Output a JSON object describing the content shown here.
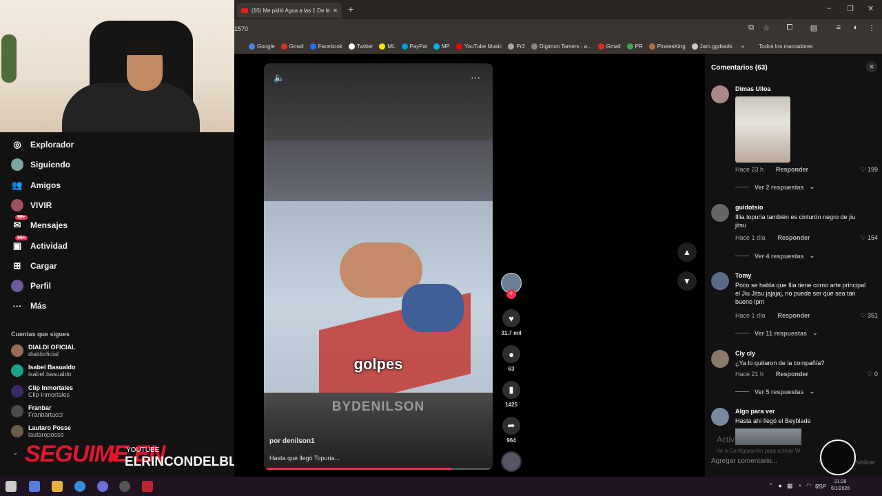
{
  "browser": {
    "tab_title": "(10) Me pidió Agua a las 1 De la",
    "new_tab": "+",
    "url_partial": "1570",
    "window_controls": [
      "–",
      "❐",
      "✕"
    ],
    "bookmarks": [
      {
        "label": "Google",
        "color": "#4285f4"
      },
      {
        "label": "Gmail",
        "color": "#d93025"
      },
      {
        "label": "Facebook",
        "color": "#1877f2"
      },
      {
        "label": "Twitter",
        "color": "#ffffff"
      },
      {
        "label": "ML",
        "color": "#ffe600"
      },
      {
        "label": "PayPal",
        "color": "#009cde"
      },
      {
        "label": "MP",
        "color": "#00b1ea"
      },
      {
        "label": "YouTube Music",
        "color": "#ff0000"
      },
      {
        "label": "Pr2",
        "color": "#aaaaaa"
      },
      {
        "label": "Digimon Tamers - a...",
        "color": "#888888"
      },
      {
        "label": "Gmail",
        "color": "#d93025"
      },
      {
        "label": "PR",
        "color": "#3aa757"
      },
      {
        "label": "PiratesKing",
        "color": "#b07040"
      },
      {
        "label": "Jam.ggdssds",
        "color": "#cccccc"
      }
    ],
    "bookmarks_more": "»",
    "all_bookmarks": "Todos los marcadores"
  },
  "sidebar": {
    "items": [
      {
        "label": "Explorador",
        "icon": "compass-icon",
        "glyph": "◎"
      },
      {
        "label": "Siguiendo",
        "icon": "following-avatar",
        "glyph": ""
      },
      {
        "label": "Amigos",
        "icon": "friends-icon",
        "glyph": "👥"
      },
      {
        "label": "VIVIR",
        "icon": "live-avatar",
        "glyph": ""
      },
      {
        "label": "Mensajes",
        "icon": "messages-icon",
        "glyph": "✉",
        "badge": "99+"
      },
      {
        "label": "Actividad",
        "icon": "activity-icon",
        "glyph": "▣",
        "badge": "99+"
      },
      {
        "label": "Cargar",
        "icon": "upload-icon",
        "glyph": "⊞"
      },
      {
        "label": "Perfil",
        "icon": "profile-avatar",
        "glyph": ""
      },
      {
        "label": "Más",
        "icon": "more-icon",
        "glyph": "···"
      }
    ],
    "following_header": "Cuentas que sigues",
    "accounts": [
      {
        "name": "DIALDI OFICIAL",
        "handle": "dialdioficial",
        "color": "#9b6b5a"
      },
      {
        "name": "Isabel Basualdo",
        "handle": "isabel.basualdo",
        "color": "#1aa58a"
      },
      {
        "name": "Clip Inmortales",
        "handle": "Clip Inmortales",
        "color": "#3b2a66"
      },
      {
        "name": "Franbar",
        "handle": "Franbartucci",
        "color": "#4a4a4a"
      },
      {
        "name": "Lautaro Posse",
        "handle": "lautaroposse",
        "color": "#6a5a4a"
      }
    ]
  },
  "overlay": {
    "seguime": "SEGUIME EN",
    "platform": "YOUTUBE",
    "channel": "ELRINCONDELBLITO"
  },
  "video": {
    "caption": "golpes",
    "watermark": "BYDENILSON",
    "author": "por denilson1",
    "description": "Hasta que llegó Topuria...",
    "progress_fraction": 0.82,
    "mute_icon": "🔈",
    "more_icon": "···"
  },
  "actions": {
    "likes": "31.7 mil",
    "comments": "63",
    "saves": "1425",
    "shares": "964"
  },
  "comments": {
    "title": "Comentarios (63)",
    "close": "✕",
    "items": [
      {
        "name": "Dimas Ulloa",
        "text": "",
        "time": "Hace 23 h",
        "reply": "Responder",
        "likes": "♡ 199",
        "replies": "Ver 2 respuestas",
        "color": "#a88"
      },
      {
        "name": "guidotsio",
        "text": "Illia topuria también es cinturón negro de jiu jitsu",
        "time": "Hace 1 día",
        "reply": "Responder",
        "likes": "♡ 154",
        "replies": "Ver 4 respuestas",
        "color": "#666"
      },
      {
        "name": "Tomy",
        "text": "Poco se habla que Ilia tiene como arte principal el Jiu Jitsu jajajaj, no puede ser que sea tan bueno lpm",
        "time": "Hace 1 día",
        "reply": "Responder",
        "likes": "♡ 351",
        "replies": "Ver 11 respuestas",
        "color": "#5a6a8a"
      },
      {
        "name": "Cly cly",
        "text": "¿Ya lo quitaron de la compañía?",
        "time": "Hace 21 h",
        "reply": "Responder",
        "likes": "♡ 0",
        "replies": "Ver 5 respuestas",
        "color": "#8a7a6a"
      },
      {
        "name": "Algo para ver",
        "text": "Hasta ahí llegó el Beyblade",
        "time": "",
        "reply": "",
        "likes": "",
        "replies": "",
        "color": "#7a8aa0"
      }
    ],
    "input_placeholder": "Agregar comentario...",
    "post_label": "Publicar",
    "activate_title": "Activ",
    "activate_sub": "Ve a Configuración para activar W"
  },
  "taskbar": {
    "lang": "ESP",
    "time": "21:28",
    "date": "6/1/2026"
  }
}
